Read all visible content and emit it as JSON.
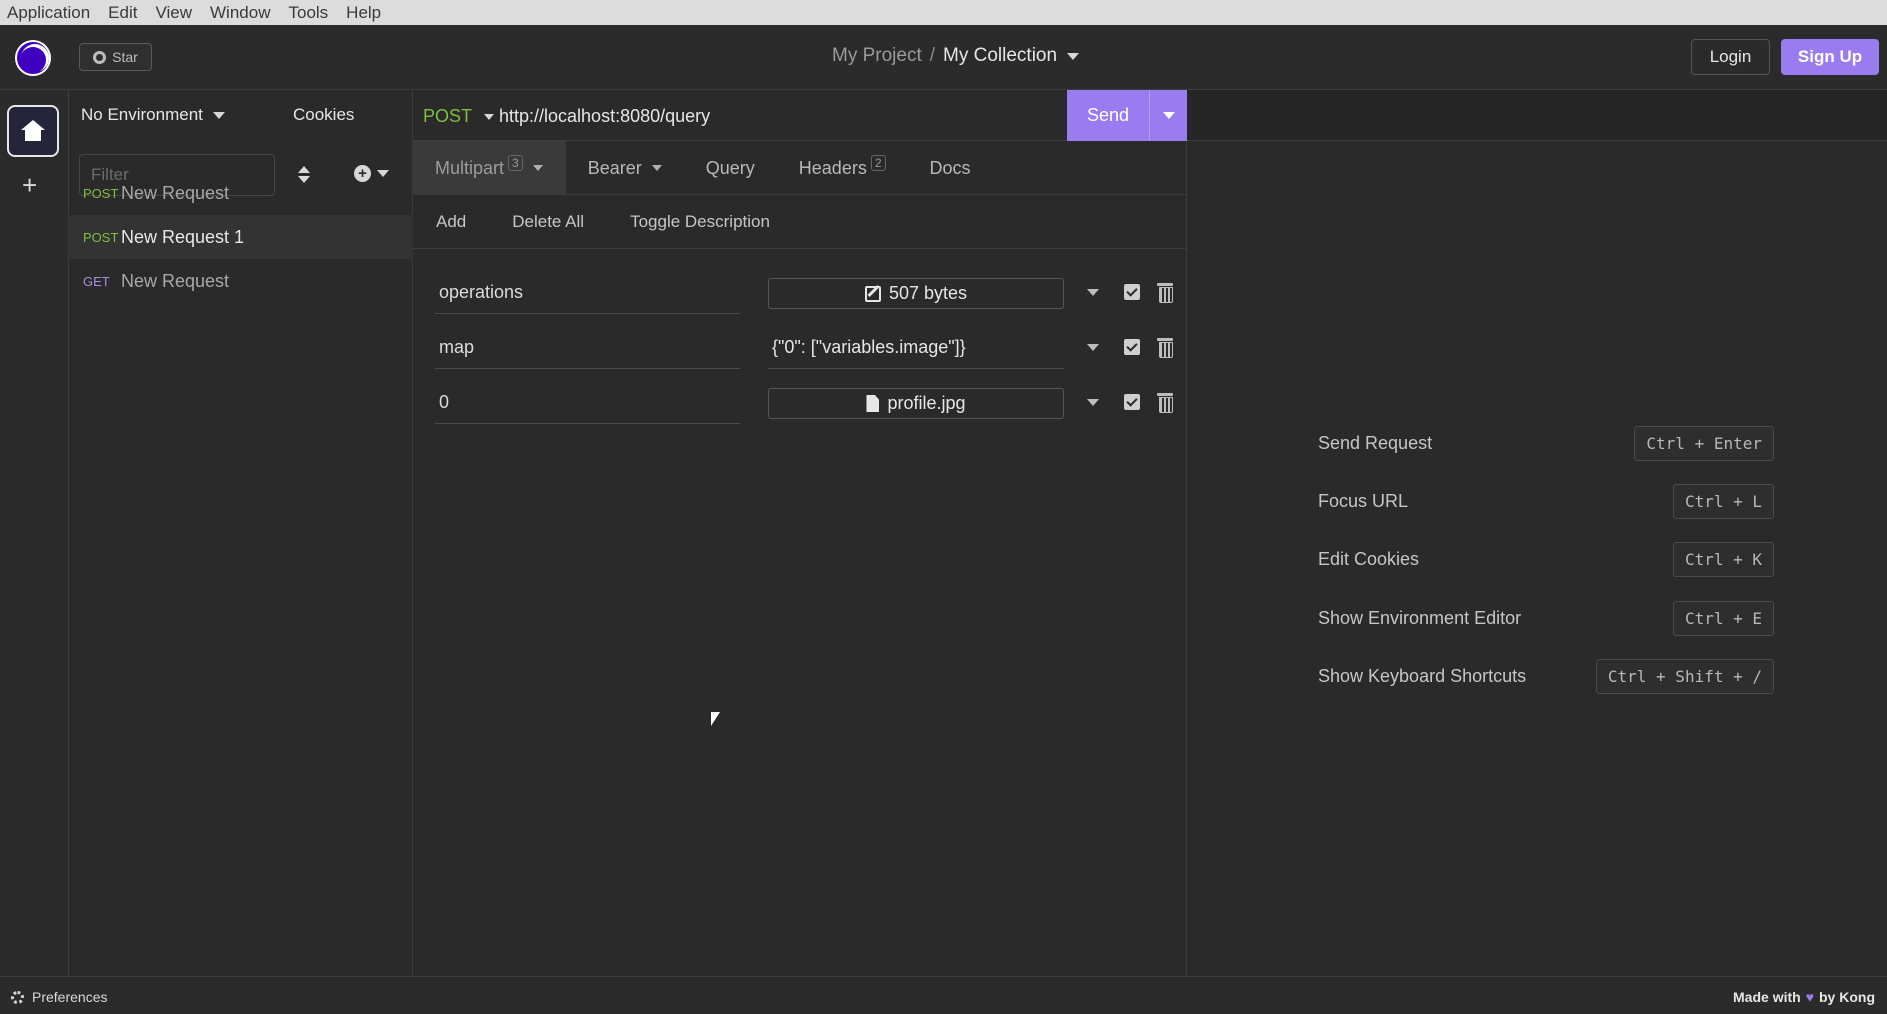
{
  "menubar": [
    "Application",
    "Edit",
    "View",
    "Window",
    "Tools",
    "Help"
  ],
  "header": {
    "star_label": "Star",
    "project": "My Project",
    "separator": "/",
    "collection": "My Collection",
    "login": "Login",
    "signup": "Sign Up"
  },
  "sidebar": {
    "environment": "No Environment",
    "cookies": "Cookies",
    "filter_placeholder": "Filter",
    "requests": [
      {
        "method": "POST",
        "name": "New Request"
      },
      {
        "method": "POST",
        "name": "New Request 1"
      },
      {
        "method": "GET",
        "name": "New Request"
      }
    ]
  },
  "request": {
    "method": "POST",
    "url": "http://localhost:8080/query",
    "send": "Send",
    "tabs": [
      {
        "label": "Multipart",
        "badge": "3"
      },
      {
        "label": "Bearer",
        "badge": ""
      },
      {
        "label": "Query",
        "badge": ""
      },
      {
        "label": "Headers",
        "badge": "2"
      },
      {
        "label": "Docs",
        "badge": ""
      }
    ],
    "actions": {
      "add": "Add",
      "delete_all": "Delete All",
      "toggle_description": "Toggle Description"
    },
    "params": [
      {
        "key": "operations",
        "value": "507 bytes"
      },
      {
        "key": "map",
        "value": "{\"0\": [\"variables.image\"]}"
      },
      {
        "key": "0",
        "value": "profile.jpg"
      }
    ]
  },
  "shortcuts": [
    {
      "label": "Send Request",
      "keys": "Ctrl + Enter"
    },
    {
      "label": "Focus URL",
      "keys": "Ctrl + L"
    },
    {
      "label": "Edit Cookies",
      "keys": "Ctrl + K"
    },
    {
      "label": "Show Environment Editor",
      "keys": "Ctrl + E"
    },
    {
      "label": "Show Keyboard Shortcuts",
      "keys": "Ctrl + Shift + /"
    }
  ],
  "footer": {
    "preferences": "Preferences",
    "made_with": "Made with",
    "by": "by Kong"
  },
  "colors": {
    "accent": "#9a7cf0",
    "post": "#7fbf3f",
    "get": "#a391e6"
  }
}
